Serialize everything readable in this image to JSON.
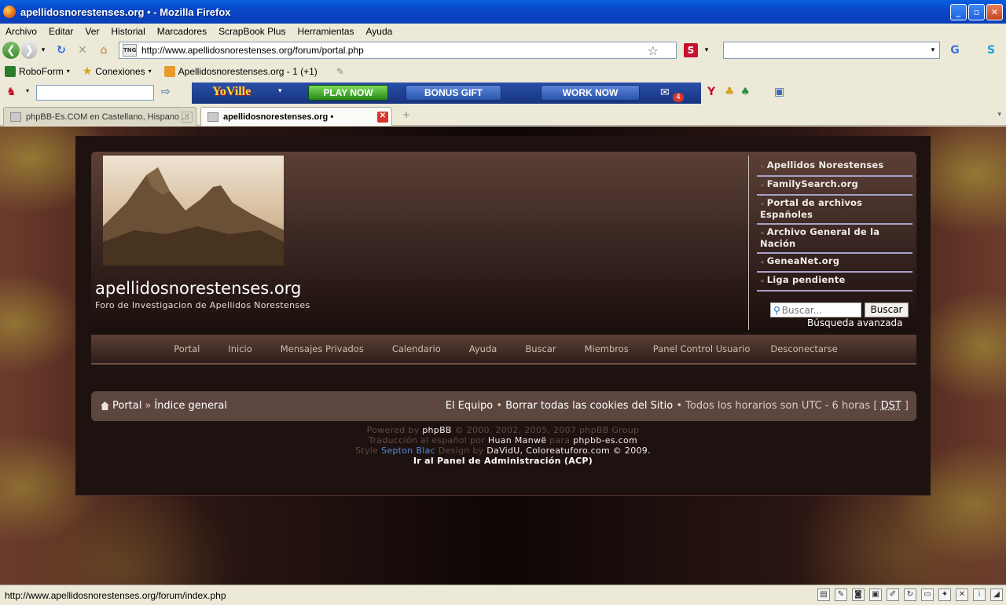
{
  "window": {
    "title": "apellidosnorestenses.org • - Mozilla Firefox"
  },
  "menubar": [
    "Archivo",
    "Editar",
    "Ver",
    "Historial",
    "Marcadores",
    "ScrapBook Plus",
    "Herramientas",
    "Ayuda"
  ],
  "navbar": {
    "url": "http://www.apellidosnorestenses.org/forum/portal.php",
    "search_engine_letter": "S"
  },
  "bookmarks": [
    {
      "label": "RoboForm",
      "icon": "roboform-icon"
    },
    {
      "label": "Conexiones",
      "icon": "star-icon"
    },
    {
      "label": "Apellidosnorestenses.org - 1 (+1)",
      "icon": "feed-icon"
    }
  ],
  "yoville": {
    "logo": "YoVille",
    "play": "PLAY NOW",
    "bonus": "BONUS GIFT",
    "work": "WORK NOW",
    "mail_count": "4"
  },
  "tabs": [
    {
      "label": "phpBB-Es.COM en Castellano, Hispano ...",
      "active": false
    },
    {
      "label": "apellidosnorestenses.org •",
      "active": true
    }
  ],
  "site": {
    "title": "apellidosnorestenses.org",
    "description": "Foro de Investigacion de Apellidos Norestenses",
    "links": [
      "Apellidos Norestenses",
      "FamilySearch.org",
      "Portal de archivos Españoles",
      "Archivo General de la Nación",
      "GeneaNet.org",
      "Liga pendiente"
    ],
    "search_placeholder": "Buscar...",
    "search_button": "Buscar",
    "advanced_search": "Búsqueda avanzada",
    "nav": [
      "Portal",
      "Inicio",
      "Mensajes Privados",
      "Calendario",
      "Ayuda",
      "Buscar",
      "Miembros",
      "Panel Control Usuario",
      "Desconectarse"
    ],
    "breadcrumb": {
      "portal": "Portal",
      "sep": "»",
      "index": "Índice general"
    },
    "crumb_right": {
      "team": "El Equipo",
      "bullet": "•",
      "cookies": "Borrar todas las cookies del Sitio",
      "tz": "Todos los horarios son UTC - 6 horas [",
      "dst": "DST",
      "close": "]"
    },
    "footer": {
      "powered_pre": "Powered by",
      "phpbb": "phpBB",
      "powered_post": "© 2000, 2002, 2005, 2007 phpBB Group",
      "trans_pre": "Traducción al español por",
      "translator": "Huan Manwë",
      "trans_para": "para",
      "trans_site": "phpbb-es.com",
      "style_pre": "Style",
      "style_name": "Septon Blac",
      "design_pre": "Design by",
      "design_by": "DaVidU,",
      "design_site": "Coloreatuforo.com © 2009.",
      "acp": "Ir al Panel de Administración (ACP)"
    }
  },
  "status": {
    "text": "http://www.apellidosnorestenses.org/forum/index.php"
  }
}
